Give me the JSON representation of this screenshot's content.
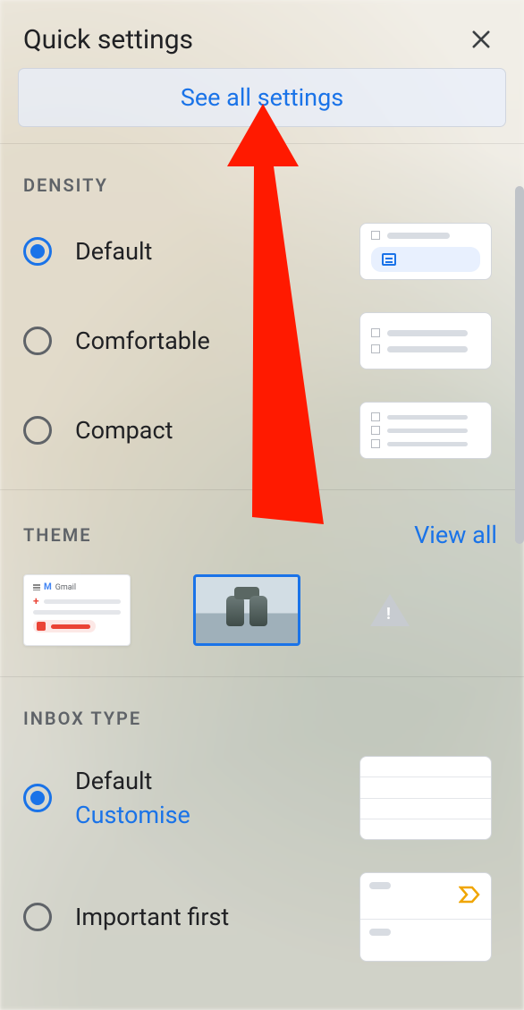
{
  "header": {
    "title": "Quick settings"
  },
  "see_all": {
    "label": "See all settings"
  },
  "density": {
    "title": "DENSITY",
    "options": [
      {
        "label": "Default",
        "selected": true
      },
      {
        "label": "Comfortable",
        "selected": false
      },
      {
        "label": "Compact",
        "selected": false
      }
    ]
  },
  "theme": {
    "title": "THEME",
    "view_all": "View all",
    "gmail_label": "Gmail"
  },
  "inbox": {
    "title": "INBOX TYPE",
    "options": [
      {
        "label": "Default",
        "customise": "Customise",
        "selected": true
      },
      {
        "label": "Important first",
        "selected": false
      }
    ]
  }
}
